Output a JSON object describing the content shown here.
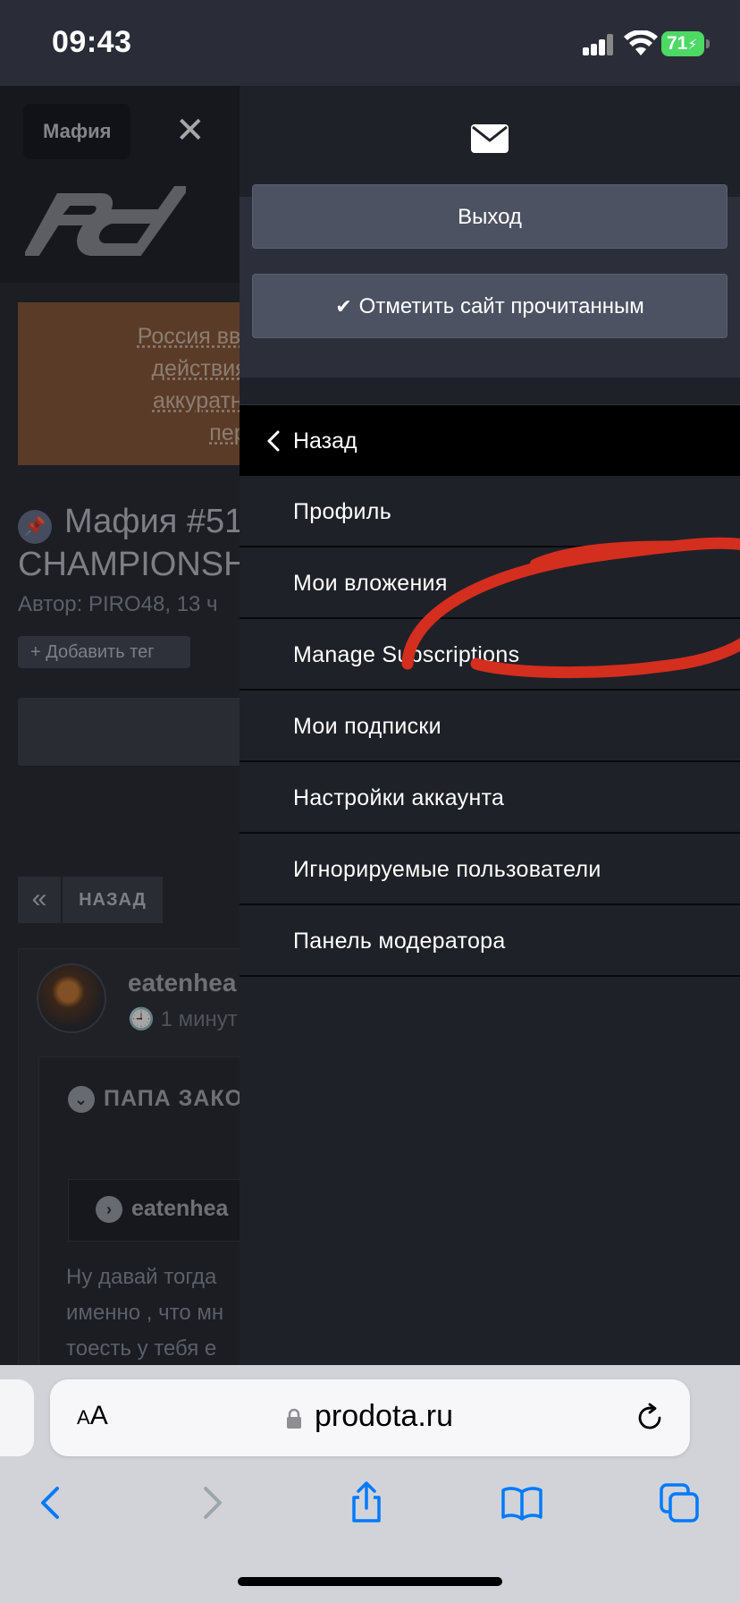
{
  "status": {
    "time": "09:43",
    "battery": "71"
  },
  "page": {
    "tab_label": "Мафия",
    "banner_lines": [
      "Россия ввела у",
      "действиях ВС",
      "аккуратны, ос",
      "персона"
    ],
    "thread_title_line1": "Мафия #51",
    "thread_title_line2": "CHAMPIONSH",
    "thread_meta": "Автор: PIRO48, 13 ч",
    "add_tag_label": "+ Добавить тег",
    "nav_back_label": "НАЗАД",
    "post_author": "eatenhea",
    "post_time": "1 минут",
    "quote_header": "ПАПА ЗАКО",
    "inner_quote_author": "eatenhea",
    "post_text_lines": [
      "Ну давай тогда",
      "именно , что мн",
      "тоесть у тебя е"
    ]
  },
  "menu": {
    "logout_label": "Выход",
    "mark_read_label": "Отметить сайт прочитанным",
    "back_label": "Назад",
    "items": [
      {
        "label": "Профиль"
      },
      {
        "label": "Мои вложения"
      },
      {
        "label": "Manage Subscriptions"
      },
      {
        "label": "Мои подписки"
      },
      {
        "label": "Настройки аккаунта"
      },
      {
        "label": "Игнорируемые пользователи"
      },
      {
        "label": "Панель модератора"
      }
    ]
  },
  "browser": {
    "text_size_label": "AA",
    "url": "prodota.ru"
  },
  "icons": {
    "mail": "mail-icon",
    "close": "close-icon",
    "back_chevron": "chevron-left-icon",
    "lock": "lock-icon",
    "reload": "reload-icon",
    "share": "share-icon",
    "bookmarks": "bookmarks-icon",
    "tabs": "tabs-icon"
  },
  "colors": {
    "accent_blue": "#007aff",
    "battery_green": "#4cd964",
    "annotation_red": "#d42e1e",
    "banner": "#8b5b3e",
    "menu_bg": "#1f2128"
  }
}
